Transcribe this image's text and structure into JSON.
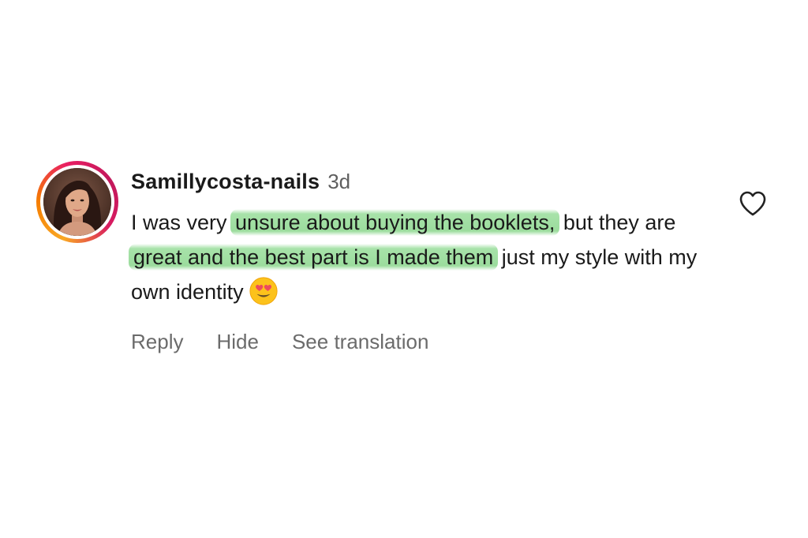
{
  "comment": {
    "username": "Samillycosta-nails",
    "time": "3d",
    "text_parts": {
      "p1": "I was very ",
      "h1": "unsure about buying the booklets,",
      "p2": " but they are ",
      "h2": "great and the best part is I made them",
      "p3": " just my style with my own identity"
    },
    "emoji": "heart-eyes-emoji",
    "actions": {
      "reply": "Reply",
      "hide": "Hide",
      "see_translation": "See translation"
    },
    "like_icon": "heart-outline-icon",
    "colors": {
      "highlight": "#98dd9a",
      "ring_start": "#f9a825",
      "ring_end": "#e91e63",
      "secondary_text": "#6b6b6b"
    }
  }
}
